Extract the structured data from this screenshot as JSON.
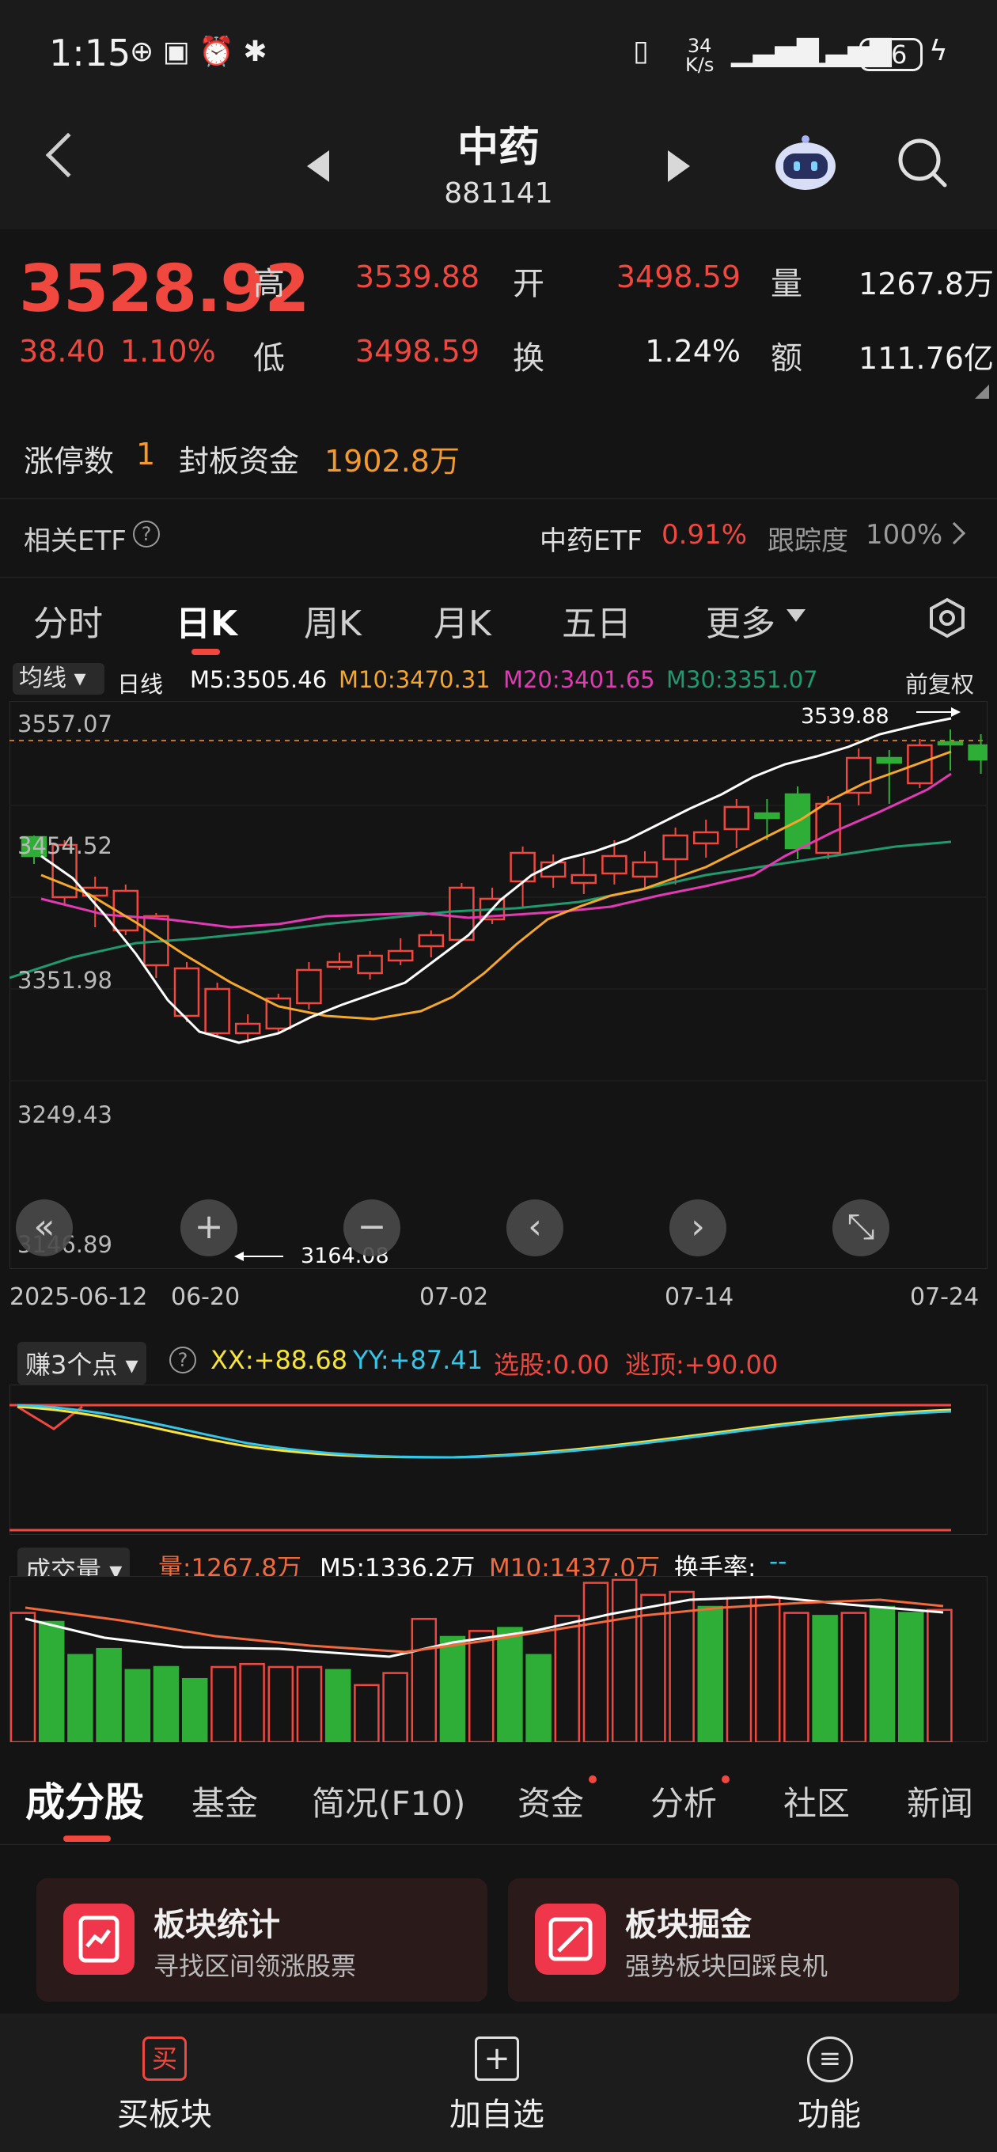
{
  "status_bar": {
    "time": "1:15",
    "net_speed_top": "34",
    "net_speed_unit": "K/s",
    "battery": "76"
  },
  "header": {
    "title": "中药",
    "code": "881141"
  },
  "quote": {
    "price": "3528.92",
    "change": "38.40",
    "change_pct": "1.10%",
    "high_label": "高",
    "high": "3539.88",
    "open_label": "开",
    "open": "3498.59",
    "volume_label": "量",
    "volume": "1267.8万",
    "low_label": "低",
    "low": "3498.59",
    "turnover_label": "换",
    "turnover": "1.24%",
    "amount_label": "额",
    "amount": "111.76亿"
  },
  "limit_row": {
    "count_label": "涨停数",
    "count": "1",
    "fund_label": "封板资金",
    "fund": "1902.8万"
  },
  "etf_row": {
    "label": "相关ETF",
    "etf_name": "中药ETF",
    "etf_change": "0.91%",
    "track_label": "跟踪度",
    "track_value": "100%"
  },
  "chart_tabs": [
    "分时",
    "日K",
    "周K",
    "月K",
    "五日",
    "更多"
  ],
  "ma_row": {
    "mode": "均线",
    "period": "日线",
    "m5": "M5:3505.46",
    "m10": "M10:3470.31",
    "m20": "M20:3401.65",
    "m30": "M30:3351.07",
    "adjust": "前复权"
  },
  "kchart": {
    "y_labels": [
      "3557.07",
      "3454.52",
      "3351.98",
      "3249.43",
      "3146.89"
    ],
    "x_labels": [
      "2025-06-12",
      "06-20",
      "07-02",
      "07-14",
      "07-24"
    ],
    "high_marker": "3539.88",
    "low_marker": "3164.08"
  },
  "indicator": {
    "name": "赚3个点",
    "xx": "XX:+88.68",
    "yy": "YY:+87.41",
    "pick": "选股:0.00",
    "escape": "逃顶:+90.00"
  },
  "volume": {
    "name": "成交量",
    "vol": "量:1267.8万",
    "m5": "M5:1336.2万",
    "m10": "M10:1437.0万",
    "turnover": "换手率:",
    "turnover_value": "--"
  },
  "bottom_tabs": [
    "成分股",
    "基金",
    "简况(F10)",
    "资金",
    "分析",
    "社区",
    "新闻"
  ],
  "cards": [
    {
      "title": "板块统计",
      "sub": "寻找区间领涨股票"
    },
    {
      "title": "板块掘金",
      "sub": "强势板块回踩良机"
    }
  ],
  "footer": {
    "buy_icon_text": "买",
    "buy": "买板块",
    "add": "加自选",
    "func": "功能"
  },
  "colors": {
    "up": "#f0483e",
    "down": "#2fae37",
    "ma5": "#ffffff",
    "ma10": "#f4a72a",
    "ma20": "#e23ab5",
    "ma30": "#1f9a6e"
  }
}
